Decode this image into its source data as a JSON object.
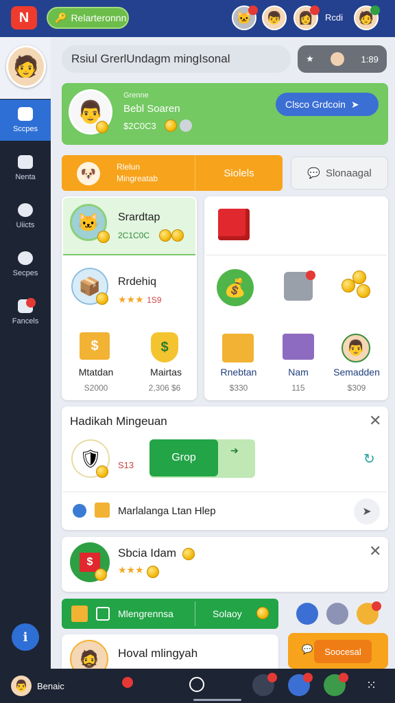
{
  "topbar": {
    "logo": "N",
    "button_label": "Relarteronnn",
    "user_label": "Rcdi"
  },
  "sidebar": {
    "items": [
      {
        "label": "Sccpes"
      },
      {
        "label": "Nenta"
      },
      {
        "label": "Uiicts"
      },
      {
        "label": "Secpes"
      },
      {
        "label": "Fancels"
      }
    ]
  },
  "search": {
    "placeholder": "Rsiul GrerlUndagm mingIsonal"
  },
  "pill": {
    "value": "1:89"
  },
  "profile": {
    "small": "Grenne",
    "name": "Bebl Soaren",
    "amount": "$2C0C3",
    "button": "Clsco Grdcoin"
  },
  "tabs": {
    "tab1_line1": "Rlelun",
    "tab1_line2": "Mingreatab",
    "tab2": "Siolels",
    "tab3": "Slonaagal"
  },
  "grid_left": {
    "featured": {
      "title": "Srardtap",
      "amount": "2C1C0C"
    },
    "second": {
      "title": "Rrdehiq",
      "rating": "1S9"
    },
    "items": [
      {
        "label": "Mtatdan",
        "value": "S2000"
      },
      {
        "label": "Mairtas",
        "value": "2,306 $6"
      }
    ]
  },
  "grid_right": {
    "items": [
      {
        "label": "Rnebtan",
        "value": "$330"
      },
      {
        "label": "Nam",
        "value": "115"
      },
      {
        "label": "Semadden",
        "value": "$309"
      }
    ]
  },
  "reward": {
    "title": "Hadikah Mingeuan",
    "value": "S13",
    "button": "Grop",
    "row_text": "Marlalanga Ltan Hlep"
  },
  "card2": {
    "title": "Sbcia Idam"
  },
  "greenbar": {
    "label1": "Mlengrennsa",
    "label2": "Solaoy"
  },
  "card3": {
    "title": "Hoval mlingyah"
  },
  "orangebtn": {
    "label": "Soocesal"
  },
  "bottom": {
    "label": "Benaic"
  }
}
